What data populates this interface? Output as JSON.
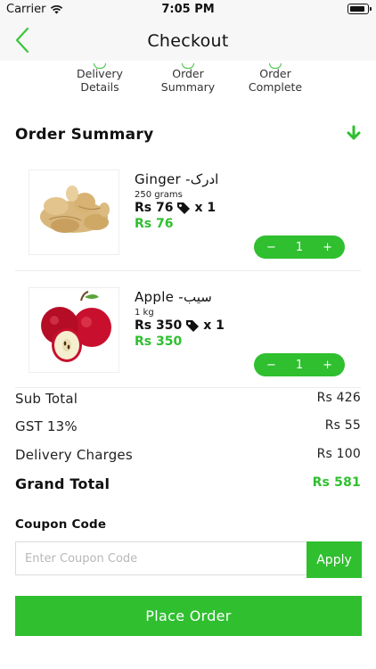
{
  "status_bar": {
    "carrier": "Carrier",
    "time": "7:05 PM"
  },
  "nav": {
    "title": "Checkout"
  },
  "steps": [
    {
      "line1": "Delivery",
      "line2": "Details"
    },
    {
      "line1": "Order",
      "line2": "Summary"
    },
    {
      "line1": "Order",
      "line2": "Complete"
    }
  ],
  "order_summary": {
    "title": "Order Summary"
  },
  "items": [
    {
      "name": "Ginger  -ادرک",
      "weight": "250 grams",
      "price": "Rs 76",
      "qty_text": "x  1",
      "total": "Rs 76",
      "quantity": "1",
      "minus": "−",
      "plus": "+"
    },
    {
      "name": "Apple  -سیب",
      "weight": "1 kg",
      "price": "Rs 350",
      "qty_text": "x  1",
      "total": "Rs 350",
      "quantity": "1",
      "minus": "−",
      "plus": "+"
    }
  ],
  "totals": {
    "sub_total_label": "Sub Total",
    "sub_total": "Rs 426",
    "gst_label": "GST 13%",
    "gst": "Rs 55",
    "delivery_label": "Delivery Charges",
    "delivery": "Rs 100",
    "grand_label": "Grand Total",
    "grand": "Rs 581"
  },
  "coupon": {
    "label": "Coupon Code",
    "placeholder": "Enter Coupon Code",
    "value": "",
    "apply": "Apply"
  },
  "place_order": "Place Order",
  "colors": {
    "accent": "#2fbf2f",
    "nav_bg": "#f7f7f7"
  },
  "icons": {
    "back": "chevron-left-icon",
    "collapse": "arrow-down-icon",
    "tag": "tag-icon"
  }
}
